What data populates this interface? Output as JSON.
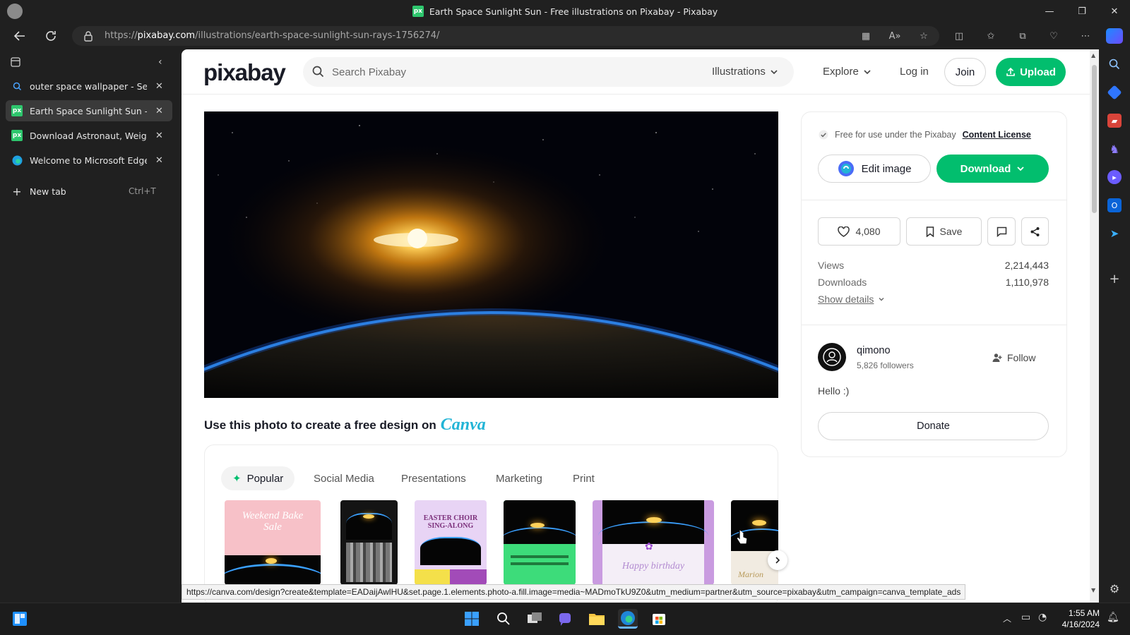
{
  "window": {
    "title": "Earth Space Sunlight Sun - Free illustrations on Pixabay - Pixabay",
    "favicon_text": "px"
  },
  "address_bar": {
    "url_prefix": "https://",
    "url_domain": "pixabay.com",
    "url_path": "/illustrations/earth-space-sunlight-sun-rays-1756274/"
  },
  "tabs": [
    {
      "label": "outer space wallpaper - Search",
      "icon": "search-icon",
      "active": false
    },
    {
      "label": "Earth Space Sunlight Sun - Free illustrations on Pixabay",
      "icon": "pixabay-icon",
      "active": true
    },
    {
      "label": "Download Astronaut, Weightless",
      "icon": "pixabay-icon",
      "active": false
    },
    {
      "label": "Welcome to Microsoft Edge",
      "icon": "edge-icon",
      "active": false
    }
  ],
  "new_tab": {
    "label": "New tab",
    "shortcut": "Ctrl+T"
  },
  "header": {
    "logo": "pixabay",
    "search_placeholder": "Search Pixabay",
    "media_type": "Illustrations",
    "explore": "Explore",
    "login": "Log in",
    "join": "Join",
    "upload": "Upload"
  },
  "canva": {
    "heading": "Use this photo to create a free design on",
    "brand": "Canva",
    "tabs": [
      "Popular",
      "Social Media",
      "Presentations",
      "Marketing",
      "Print"
    ],
    "thumb_texts": {
      "bake_sale": "Weekend Bake Sale",
      "easter": "EASTER CHOIR SING-ALONG",
      "birthday": "Happy birthday",
      "marion": "Marion"
    }
  },
  "sidebar_card": {
    "license_text": "Free for use under the Pixabay",
    "license_link": "Content License",
    "edit_image": "Edit image",
    "download": "Download",
    "likes": "4,080",
    "save": "Save",
    "stats": [
      {
        "label": "Views",
        "value": "2,214,443"
      },
      {
        "label": "Downloads",
        "value": "1,110,978"
      }
    ],
    "show_details": "Show details",
    "user": {
      "name": "qimono",
      "followers": "5,826 followers",
      "follow": "Follow",
      "bio": "Hello :)"
    },
    "donate": "Donate"
  },
  "status_url": "https://canva.com/design?create&template=EADaijAwlHU&set.page.1.elements.photo-a.fill.image=media~MADmoTkU9Z0&utm_medium=partner&utm_source=pixabay&utm_campaign=canva_template_ads",
  "clock": {
    "time": "1:55 AM",
    "date": "4/16/2024"
  },
  "colors": {
    "brand_green": "#02be6e",
    "canva_blue": "#22b4d6"
  }
}
